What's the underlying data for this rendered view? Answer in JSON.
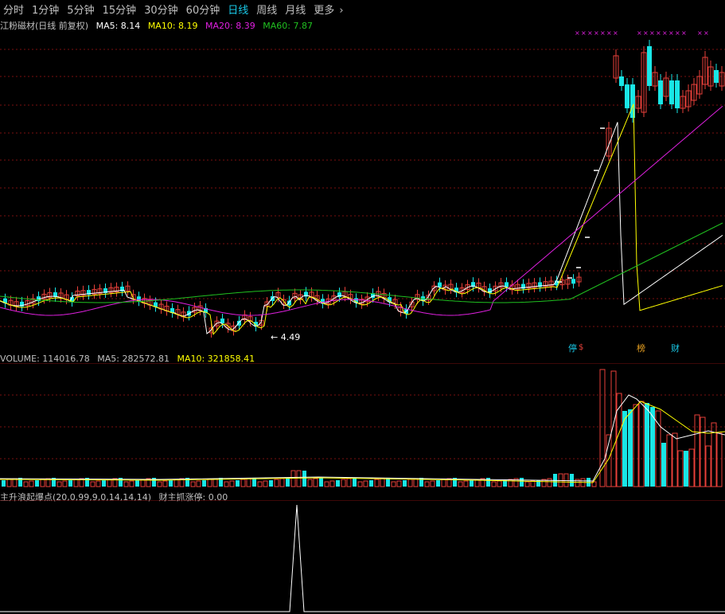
{
  "toolbar": {
    "tabs": [
      {
        "label": "分时"
      },
      {
        "label": "1分钟"
      },
      {
        "label": "5分钟"
      },
      {
        "label": "15分钟"
      },
      {
        "label": "30分钟"
      },
      {
        "label": "60分钟"
      },
      {
        "label": "日线"
      },
      {
        "label": "周线"
      },
      {
        "label": "月线"
      },
      {
        "label": "更多"
      }
    ],
    "active_tab": "日线",
    "more_chevron": "›"
  },
  "price_panel": {
    "title": "江粉磁材(日线 前复权)",
    "ma5": "MA5: 8.14",
    "ma10": "MA10: 8.19",
    "ma20": "MA20: 8.39",
    "ma60": "MA60: 7.87",
    "low_label": "4.49",
    "markers": [
      "停",
      "$",
      "榜",
      "财"
    ]
  },
  "volume_panel": {
    "volume": "VOLUME: 114016.78",
    "ma5": "MA5: 282572.81",
    "ma10": "MA10: 321858.41"
  },
  "indicator_panel": {
    "title": "主升浪起爆点(20,0,99,9,0,14,14,14)",
    "value": "财主抓涨停: 0.00"
  },
  "colors": {
    "up": "#e8403a",
    "down": "#19e6e6",
    "ma5": "#ffffff",
    "ma10": "#ffff00",
    "ma20": "#e020e0",
    "ma60": "#20c020",
    "grid": "#7a1010",
    "active_tab": "#19c8e6"
  }
}
